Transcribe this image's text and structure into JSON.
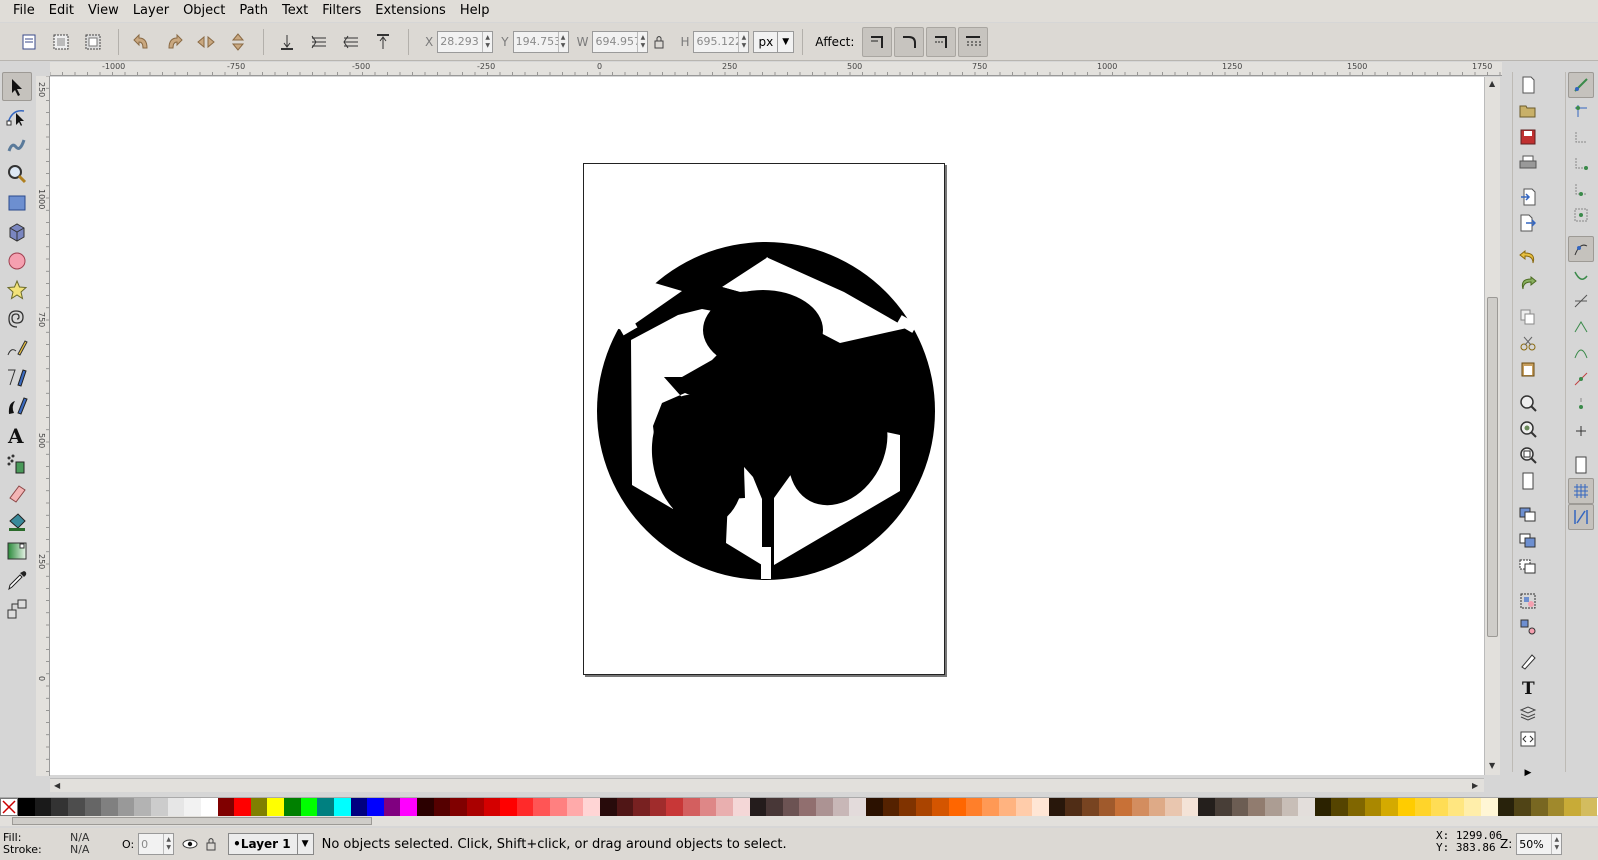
{
  "menu": [
    "File",
    "Edit",
    "View",
    "Layer",
    "Object",
    "Path",
    "Text",
    "Filters",
    "Extensions",
    "Help"
  ],
  "controls": {
    "x_label": "X",
    "x_value": "28.293",
    "y_label": "Y",
    "y_value": "194.753",
    "w_label": "W",
    "w_value": "694.957",
    "h_label": "H",
    "h_value": "695.122",
    "unit": "px",
    "affect_label": "Affect:"
  },
  "ruler": {
    "h_labels": [
      "-1000",
      "-750",
      "-500",
      "-250",
      "0",
      "250",
      "500",
      "750",
      "1000",
      "1250",
      "1500",
      "1750"
    ],
    "v_labels": [
      "250",
      "1000",
      "750",
      "500",
      "250",
      "0"
    ]
  },
  "palette": {
    "colors": [
      "#000000",
      "#1a1a1a",
      "#333333",
      "#4d4d4d",
      "#666666",
      "#808080",
      "#999999",
      "#b3b3b3",
      "#cccccc",
      "#e6e6e6",
      "#f2f2f2",
      "#ffffff",
      "#800000",
      "#ff0000",
      "#808000",
      "#ffff00",
      "#008000",
      "#00ff00",
      "#008080",
      "#00ffff",
      "#000080",
      "#0000ff",
      "#800080",
      "#ff00ff",
      "#2b0000",
      "#550000",
      "#800000",
      "#aa0000",
      "#d40000",
      "#ff0000",
      "#ff2a2a",
      "#ff5555",
      "#ff8080",
      "#ffaaaa",
      "#ffd5d5",
      "#280b0b",
      "#501616",
      "#782121",
      "#a02c2c",
      "#c83737",
      "#d35f5f",
      "#de8787",
      "#e9afaf",
      "#f4d7d7",
      "#241c1c",
      "#483737",
      "#6c5353",
      "#916f6f",
      "#ac9393",
      "#c8b7b7",
      "#e3dbdb",
      "#2b1100",
      "#552200",
      "#803300",
      "#aa4400",
      "#d45500",
      "#ff6600",
      "#ff7f2a",
      "#ff9955",
      "#ffb380",
      "#ffccaa",
      "#ffe6d5",
      "#28170b",
      "#502d16",
      "#784421",
      "#a05a2c",
      "#c87137",
      "#d38d5f",
      "#deaa87",
      "#e9c6af",
      "#f4e3d7",
      "#241f1c",
      "#483e37",
      "#6c5d53",
      "#917c6f",
      "#ac9d93",
      "#c8beb7",
      "#e3dedb",
      "#2b2200",
      "#554400",
      "#806600",
      "#aa8800",
      "#d4aa00",
      "#ffcc00",
      "#ffd42a",
      "#ffdd55",
      "#ffe680",
      "#ffeeaa",
      "#fff6d5",
      "#28220b",
      "#504416",
      "#786721",
      "#a0892c",
      "#c8ab37",
      "#d3bc5f"
    ]
  },
  "status": {
    "fill_label": "Fill:",
    "stroke_label": "Stroke:",
    "fill_value": "N/A",
    "stroke_value": "N/A",
    "opacity_label": "O:",
    "opacity_value": "0",
    "layer": "•Layer 1",
    "message": "No objects selected. Click, Shift+click, or drag around objects to select.",
    "cursor_x": "X: 1299.06",
    "cursor_y": "Y:  383.86",
    "zoom_label": "Z:",
    "zoom_value": "50%"
  }
}
